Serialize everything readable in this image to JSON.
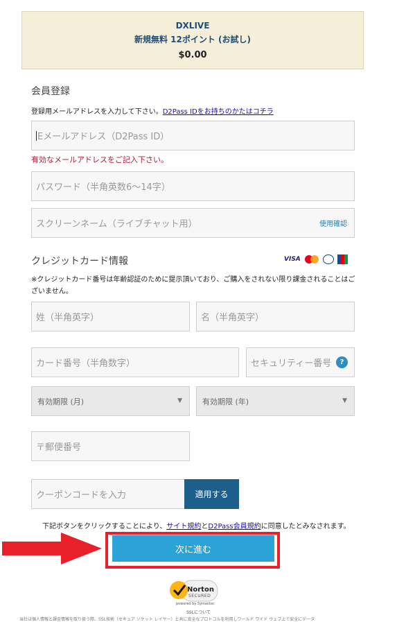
{
  "summary": {
    "brand": "DXLIVE",
    "plan": "新規無料 12ポイント (お試し)",
    "price": "$0.00"
  },
  "registration": {
    "title": "会員登録",
    "note": "登録用メールアドレスを入力して下さい。",
    "note_link": "D2Pass IDをお持ちのかたはコチラ",
    "email_placeholder": "Eメールアドレス（D2Pass ID）",
    "email_error": "有効なメールアドレスをご記入下さい。",
    "password_placeholder": "パスワード（半角英数6〜14字）",
    "screenname_placeholder": "スクリーンネーム（ライブチャット用）",
    "check_usage": "使用確認"
  },
  "credit": {
    "title": "クレジットカード情報",
    "card_logos": [
      "VISA",
      "MasterCard",
      "Diners Club",
      "JCB"
    ],
    "note": "※クレジットカード番号は年齢認証のために提示頂いており、ご購入をされない限り課金されることはございません。",
    "lastname_placeholder": "姓（半角英字）",
    "firstname_placeholder": "名（半角英字）",
    "cardnumber_placeholder": "カード番号（半角数字）",
    "security_placeholder": "セキュリティー番号",
    "help_label": "?",
    "exp_month": "有効期限 (月)",
    "exp_year": "有効期限 (年)",
    "postal_placeholder": "〒郵便番号"
  },
  "coupon": {
    "placeholder": "クーポンコードを入力",
    "apply_label": "適用する"
  },
  "agreement": {
    "prefix": "下記ボタンをクリックすることにより、",
    "terms_link": "サイト規約",
    "and": "と",
    "member_terms_link": "D2Pass会員規約",
    "suffix": "に同意したとみなされます。"
  },
  "next_label": "次に進む",
  "trust": {
    "norton": "Norton",
    "secured": "SECURED",
    "powered": "powered by Symantec",
    "ssl": "SSLについて",
    "footer": "当社は個人情報と課金情報を取り扱う際、SSL技術（セキュア ソケット レイヤー）と共に安全なプロトコルを利用しワールド ワイド ウェブ上で安全にデータ"
  },
  "colors": {
    "summary_bg": "#f5efda",
    "accent": "#2ba3d8",
    "apply_bg": "#1c5f8a",
    "error": "#b0193a",
    "highlight": "#e8202a"
  }
}
